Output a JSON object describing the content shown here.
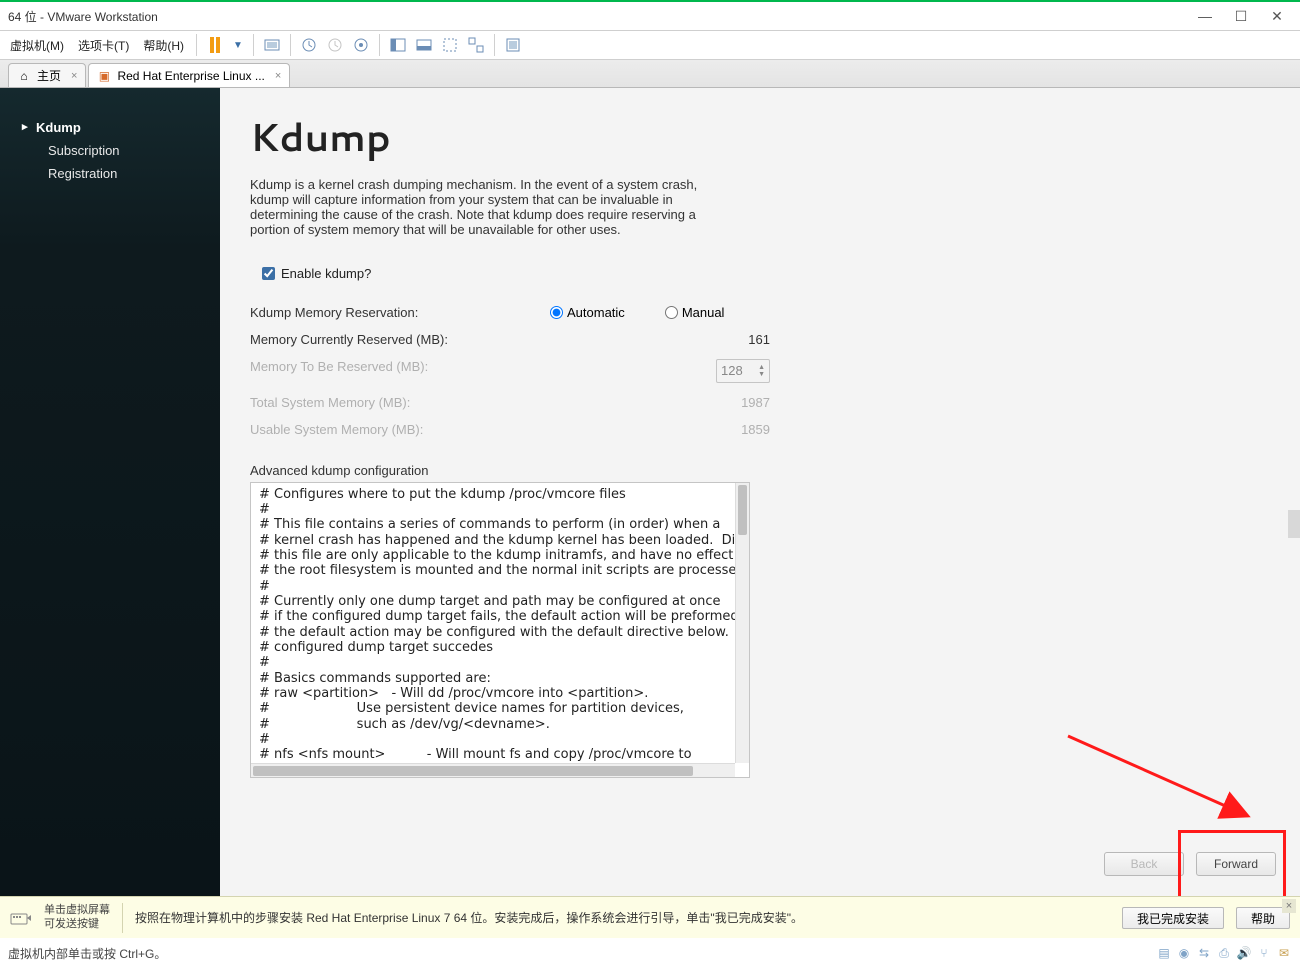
{
  "window": {
    "title_suffix": "64 位 - VMware Workstation"
  },
  "menu": {
    "vm": "虚拟机(M)",
    "tabs": "选项卡(T)",
    "help": "帮助(H)"
  },
  "tabs": {
    "home": "主页",
    "vm_name": "Red Hat Enterprise Linux ..."
  },
  "sidebar": {
    "kdump": "Kdump",
    "subscription": "Subscription",
    "registration": "Registration"
  },
  "page": {
    "title": "Kdump",
    "description": "Kdump is a kernel crash dumping mechanism. In the event of a system crash, kdump will capture information from your system that can be invaluable in determining the cause of the crash. Note that kdump does require reserving a portion of system memory that will be unavailable for other uses.",
    "enable_label": "Enable kdump?"
  },
  "fields": {
    "mem_res_label": "Kdump Memory Reservation:",
    "automatic": "Automatic",
    "manual": "Manual",
    "cur_reserved_label": "Memory Currently Reserved (MB):",
    "cur_reserved_value": "161",
    "to_be_reserved_label": "Memory To Be Reserved (MB):",
    "to_be_reserved_value": "128",
    "total_mem_label": "Total System Memory (MB):",
    "total_mem_value": "1987",
    "usable_mem_label": "Usable System Memory (MB):",
    "usable_mem_value": "1859"
  },
  "advanced": {
    "label": "Advanced kdump configuration",
    "text": "# Configures where to put the kdump /proc/vmcore files\n#\n# This file contains a series of commands to perform (in order) when a\n# kernel crash has happened and the kdump kernel has been loaded.  Direc\n# this file are only applicable to the kdump initramfs, and have no effect if\n# the root filesystem is mounted and the normal init scripts are processed\n#\n# Currently only one dump target and path may be configured at once\n# if the configured dump target fails, the default action will be preformed\n# the default action may be configured with the default directive below.  If th\n# configured dump target succedes\n#\n# Basics commands supported are:\n# raw <partition>   - Will dd /proc/vmcore into <partition>.\n#                     Use persistent device names for partition devices,\n#                     such as /dev/vg/<devname>.\n#\n# nfs <nfs mount>          - Will mount fs and copy /proc/vmcore to\n#                     <mnt>/var/crash/%HOST-%DATE/, supports DNS."
  },
  "nav": {
    "back": "Back",
    "forward": "Forward"
  },
  "yellowbar": {
    "hint_l1": "单击虚拟屏幕",
    "hint_l2": "可发送按键",
    "instruction": "按照在物理计算机中的步骤安装 Red Hat Enterprise Linux 7 64 位。安装完成后，操作系统会进行引导，单击\"我已完成安装\"。",
    "btn_done": "我已完成安装",
    "btn_help": "帮助"
  },
  "statusbar": {
    "text": "虚拟机内部单击或按 Ctrl+G。"
  }
}
